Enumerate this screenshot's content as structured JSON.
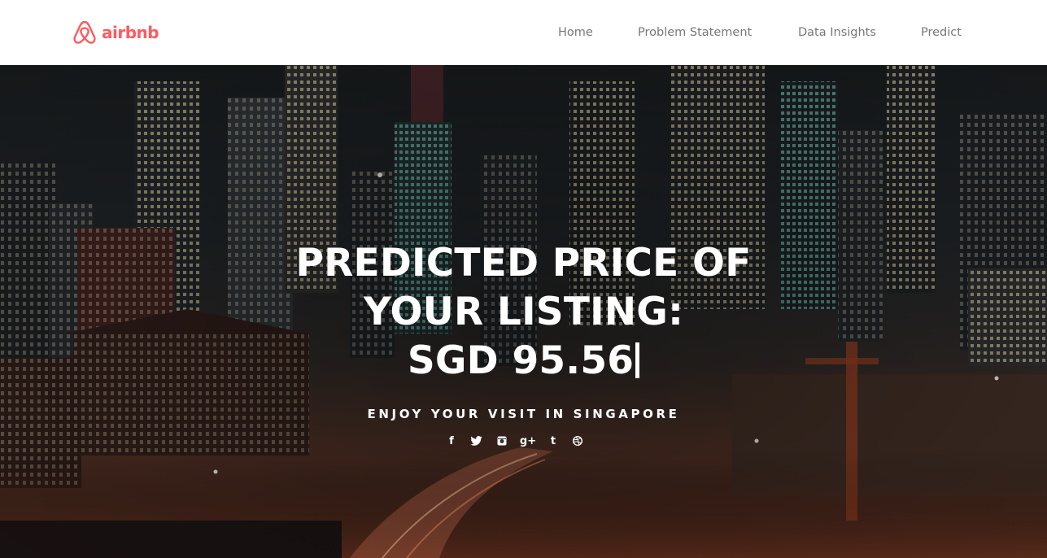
{
  "brand": {
    "name": "airbnb",
    "color": "#ff5a5f",
    "logo_icon": "airbnb-belo-icon"
  },
  "nav": {
    "items": [
      {
        "label": "Home"
      },
      {
        "label": "Problem Statement"
      },
      {
        "label": "Data Insights"
      },
      {
        "label": "Predict"
      }
    ]
  },
  "hero": {
    "background": "night-city-skyline-singapore",
    "headline_line1": "PREDICTED PRICE OF",
    "headline_line2": "YOUR LISTING:",
    "price": "SGD 95.56",
    "subtitle": "ENJOY YOUR VISIT IN SINGAPORE",
    "social_icons": [
      {
        "name": "facebook-icon",
        "glyph": "f"
      },
      {
        "name": "twitter-icon",
        "glyph": "🐦"
      },
      {
        "name": "instagram-icon",
        "glyph": "◙"
      },
      {
        "name": "google-plus-icon",
        "glyph": "g+"
      },
      {
        "name": "tumblr-icon",
        "glyph": "t"
      },
      {
        "name": "dribbble-icon",
        "glyph": "◍"
      }
    ]
  }
}
